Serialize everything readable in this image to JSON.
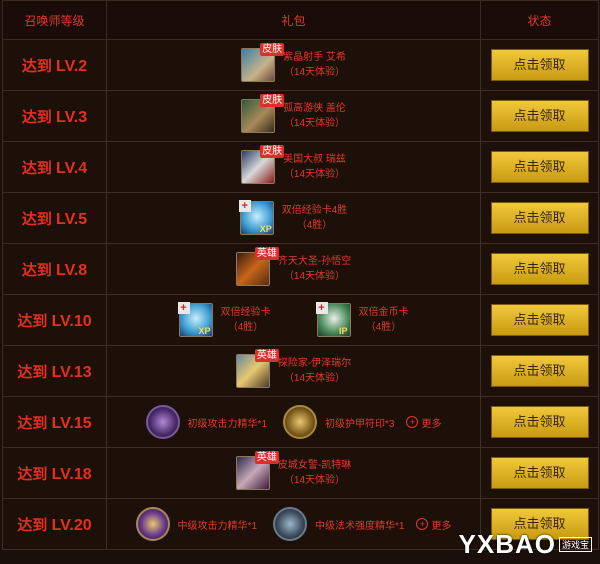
{
  "header": {
    "col1": "召唤师等级",
    "col2": "礼包",
    "col3": "状态"
  },
  "rows": [
    {
      "level_prefix": "达到",
      "level": "LV.2",
      "gift": {
        "badge": "皮肤",
        "name": "紫晶射手 艾希",
        "sub": "（14天体验）"
      },
      "button": "点击领取"
    },
    {
      "level_prefix": "达到",
      "level": "LV.3",
      "gift": {
        "badge": "皮肤",
        "name": "孤高游侠 盖伦",
        "sub": "（14天体验）"
      },
      "button": "点击领取"
    },
    {
      "level_prefix": "达到",
      "level": "LV.4",
      "gift": {
        "badge": "皮肤",
        "name": "美国大叔 瑞兹",
        "sub": "（14天体验）"
      },
      "button": "点击领取"
    },
    {
      "level_prefix": "达到",
      "level": "LV.5",
      "gift": {
        "name": "双倍经验卡4胜",
        "sub": "（4胜）",
        "xp": "XP"
      },
      "button": "点击领取"
    },
    {
      "level_prefix": "达到",
      "level": "LV.8",
      "gift": {
        "badge": "英雄",
        "name": "齐天大圣-孙悟空",
        "sub": "（14天体验）"
      },
      "button": "点击领取"
    },
    {
      "level_prefix": "达到",
      "level": "LV.10",
      "gift_a": {
        "name": "双倍经验卡",
        "sub": "（4胜）",
        "xp": "XP"
      },
      "gift_b": {
        "name": "双倍金币卡",
        "sub": "（4胜）",
        "ip": "IP"
      },
      "button": "点击领取"
    },
    {
      "level_prefix": "达到",
      "level": "LV.13",
      "gift": {
        "badge": "英雄",
        "name": "探险家-伊泽瑞尔",
        "sub": "（14天体验）"
      },
      "button": "点击领取"
    },
    {
      "level_prefix": "达到",
      "level": "LV.15",
      "gift_a": {
        "name": "初级攻击力精华*1"
      },
      "gift_b": {
        "name": "初级护甲符印*3"
      },
      "more": "更多",
      "button": "点击领取"
    },
    {
      "level_prefix": "达到",
      "level": "LV.18",
      "gift": {
        "badge": "英雄",
        "name": "皮城女警-凯特琳",
        "sub": "（14天体验）"
      },
      "button": "点击领取"
    },
    {
      "level_prefix": "达到",
      "level": "LV.20",
      "gift_a": {
        "name": "中级攻击力精华*1"
      },
      "gift_b": {
        "name": "中级法术强度精华*1"
      },
      "more": "更多",
      "button": "点击领取"
    }
  ],
  "watermark": {
    "logo": "YXBAO",
    "sub": "游戏宝"
  },
  "colors": {
    "accent_red": "#e23a2c",
    "button_gold": "#f0c93a",
    "background": "#1a0f0b"
  }
}
